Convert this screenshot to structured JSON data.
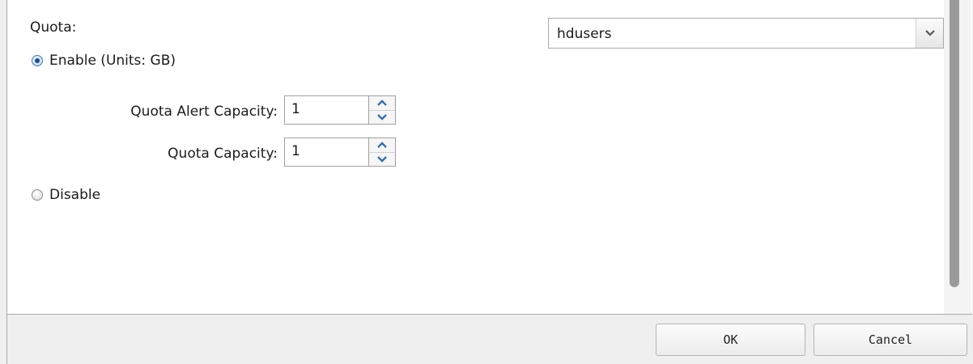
{
  "quota": {
    "title": "Quota:",
    "enable_label": "Enable (Units: GB)",
    "enable_selected": true,
    "alert_capacity_label": "Quota Alert Capacity:",
    "alert_capacity_value": "1",
    "capacity_label": "Quota Capacity:",
    "capacity_value": "1",
    "disable_label": "Disable",
    "disable_selected": false
  },
  "group_select": {
    "value": "hdusers",
    "arrow_icon": "chevron-down-icon"
  },
  "spinner_icons": {
    "up": "chevron-up-icon",
    "down": "chevron-down-icon"
  },
  "footer": {
    "ok_label": "OK",
    "cancel_label": "Cancel"
  },
  "colors": {
    "accent": "#3b6fa6",
    "background": "#efefef",
    "panel": "#ffffff"
  }
}
